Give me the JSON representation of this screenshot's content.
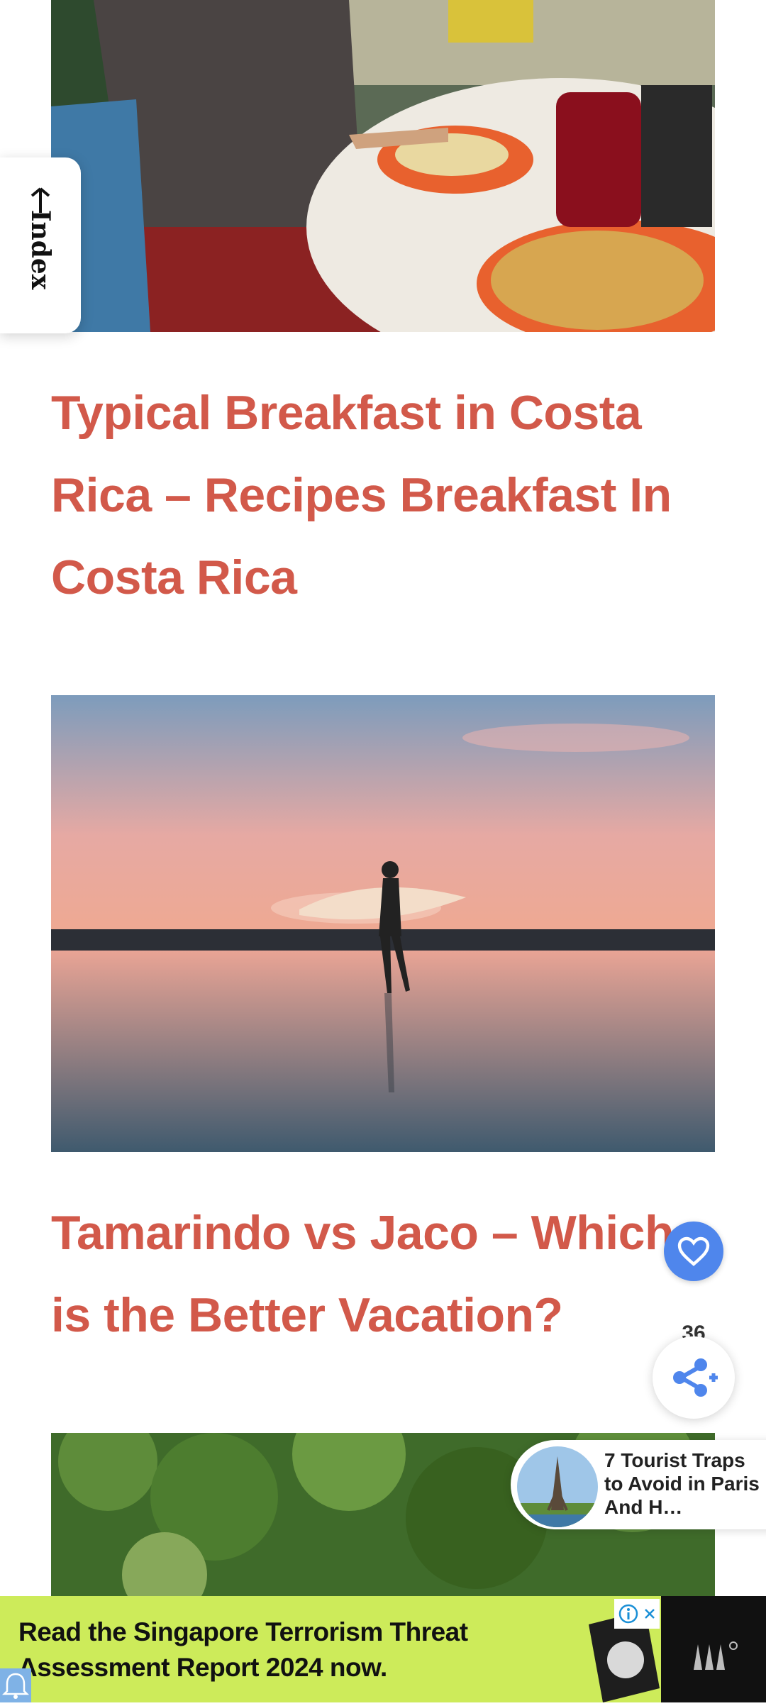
{
  "index_tab": {
    "label": "Index"
  },
  "articles": [
    {
      "title": "Typical Breakfast in Costa Rica – Recipes Breakfast In Costa Rica",
      "image": "breakfast-photo"
    },
    {
      "title": "Tamarindo vs Jaco – Which is the Better Vacation?",
      "image": "surfer-sunset-photo"
    },
    {
      "title": "",
      "image": "jungle-photo"
    }
  ],
  "actions": {
    "like_count": "36",
    "like_icon": "heart-icon",
    "share_icon": "share-icon"
  },
  "recommendation": {
    "text": "7 Tourist Traps to Avoid in Paris And H…",
    "thumb": "eiffel-tower-photo"
  },
  "ad": {
    "text": "Read the Singapore Terrorism Threat Assessment Report 2024 now.",
    "info_icon": "info-icon",
    "close_icon": "close-icon"
  },
  "colors": {
    "title": "#d2594a",
    "accent_blue": "#4f86ec",
    "ad_background": "#cdeb5a"
  }
}
